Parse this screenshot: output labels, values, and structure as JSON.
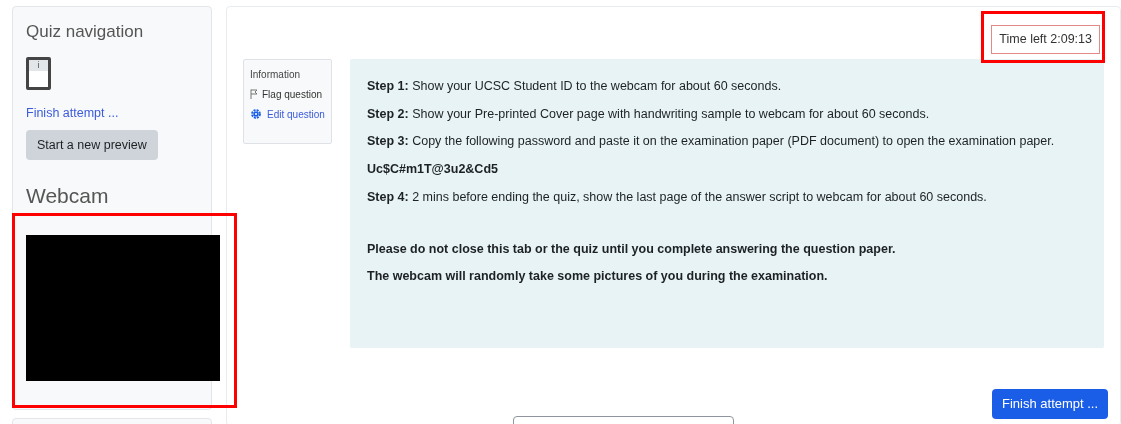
{
  "quiz_navigation": {
    "title": "Quiz navigation",
    "questions": [
      {
        "label": "i",
        "selected": true
      }
    ],
    "finish_link": "Finish attempt ...",
    "new_preview_button": "Start a new preview"
  },
  "webcam": {
    "title": "Webcam"
  },
  "timer": "Time left 2:09:13",
  "question_info": {
    "label": "Information",
    "flag": "Flag question",
    "edit": "Edit question"
  },
  "instructions": [
    {
      "kind": "step",
      "text": "**Step 1:** Show your UCSC Student ID to the webcam for about 60 seconds."
    },
    {
      "kind": "step",
      "text": "**Step 2:** Show your Pre-printed Cover page with handwriting sample to webcam for about 60 seconds."
    },
    {
      "kind": "step",
      "text": "**Step 3:** Copy the following password and paste it on the examination paper (PDF document) to open the examination paper."
    },
    {
      "kind": "password",
      "text": "Uc$C#m1T@3u2&Cd5"
    },
    {
      "kind": "step",
      "text": "**Step 4:** 2 mins before ending the quiz, show the last page of the answer script to webcam for about 60 seconds."
    },
    {
      "kind": "note",
      "text": "Please do not close this tab or the quiz until you complete answering the question paper."
    },
    {
      "kind": "note",
      "text": "The webcam will randomly take some pictures of you during the examination."
    }
  ],
  "finish_button": "Finish attempt ..."
}
